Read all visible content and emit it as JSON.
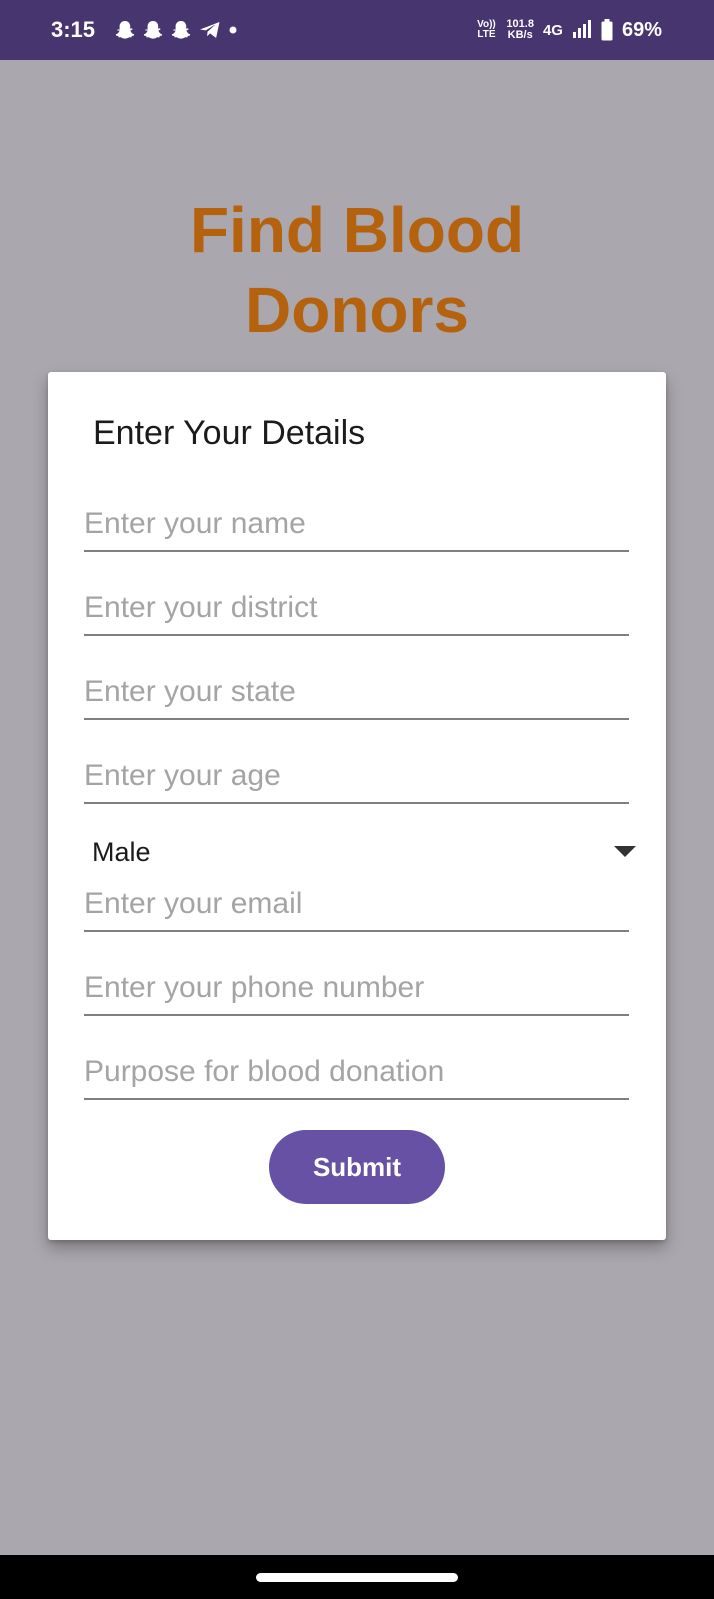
{
  "status_bar": {
    "time": "3:15",
    "notification_icons": [
      "snapchat-icon",
      "snapchat-icon",
      "snapchat-icon",
      "telegram-icon",
      "dot-icon"
    ],
    "volte_line1": "Vo))",
    "volte_line2": "LTE",
    "speed_value": "101.8",
    "speed_unit": "KB/s",
    "network_type": "4G",
    "battery_percent": "69%"
  },
  "page": {
    "title_line1": "Find Blood",
    "title_line2": "Donors"
  },
  "form": {
    "heading": "Enter Your Details",
    "name_placeholder": "Enter your name",
    "district_placeholder": "Enter your district",
    "state_placeholder": "Enter your state",
    "age_placeholder": "Enter your age",
    "gender_selected": "Male",
    "email_placeholder": "Enter your email",
    "phone_placeholder": "Enter your phone number",
    "purpose_placeholder": "Purpose for blood donation",
    "submit_label": "Submit"
  },
  "colors": {
    "status_bar_bg": "#46356F",
    "page_bg": "#ABA7AE",
    "title": "#B5620F",
    "button": "#6751A4"
  }
}
